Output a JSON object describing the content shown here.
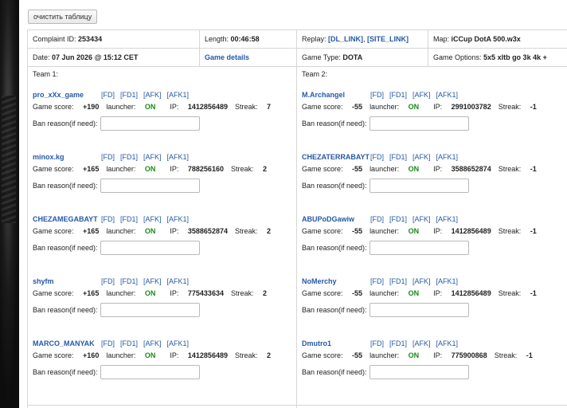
{
  "toolbar": {
    "clear_label": "очистить таблицу"
  },
  "header": {
    "complaint_label": "Complaint ID:",
    "complaint_value": "253434",
    "length_label": "Length:",
    "length_value": "00:46:58",
    "replay_label": "Replay:",
    "replay_links": [
      "[DL_LINK]",
      "[SITE_LINK]"
    ],
    "map_label": "Map:",
    "map_value": "iCCup DotA 500.w3x",
    "date_label": "Date:",
    "date_value": "07 Jun 2026 @ 15:12 CET",
    "details_label": "Game details",
    "type_label": "Game Type:",
    "type_value": "DOTA",
    "options_label": "Game Options:",
    "options_value": "5x5 xltb go 3k 4k +"
  },
  "labels": {
    "game_score": "Game score:",
    "launcher": "launcher:",
    "ip": "IP:",
    "streak": "Streak:",
    "ban_reason": "Ban reason(if need):",
    "actions": [
      "[FD]",
      "[FD1]",
      "[AFK]",
      "[AFK1]"
    ]
  },
  "team1": {
    "title": "Team 1:",
    "players": [
      {
        "name": "pro_xXx_game",
        "score": "+190",
        "launcher": "ON",
        "ip": "1412856489",
        "streak": "7"
      },
      {
        "name": "minox.kg",
        "score": "+165",
        "launcher": "ON",
        "ip": "788256160",
        "streak": "2"
      },
      {
        "name": "CHEZAMEGABAYT",
        "score": "+165",
        "launcher": "ON",
        "ip": "3588652874",
        "streak": "2"
      },
      {
        "name": "shyfm",
        "score": "+165",
        "launcher": "ON",
        "ip": "775433634",
        "streak": "2"
      },
      {
        "name": "MARCO_MANYAK",
        "score": "+160",
        "launcher": "ON",
        "ip": "1412856489",
        "streak": "2"
      }
    ]
  },
  "team2": {
    "title": "Team 2:",
    "players": [
      {
        "name": "M.Archangel",
        "score": "-55",
        "launcher": "ON",
        "ip": "2991003782",
        "streak": "-1"
      },
      {
        "name": "CHEZATERRABAYT",
        "score": "-55",
        "launcher": "ON",
        "ip": "3588652874",
        "streak": "-1"
      },
      {
        "name": "ABUPoDGawiw",
        "score": "-55",
        "launcher": "ON",
        "ip": "1412856489",
        "streak": "-1"
      },
      {
        "name": "NoMerchy",
        "score": "-55",
        "launcher": "ON",
        "ip": "1412856489",
        "streak": "-1"
      },
      {
        "name": "Dmutro1",
        "score": "-55",
        "launcher": "ON",
        "ip": "775900868",
        "streak": "-1"
      }
    ]
  }
}
